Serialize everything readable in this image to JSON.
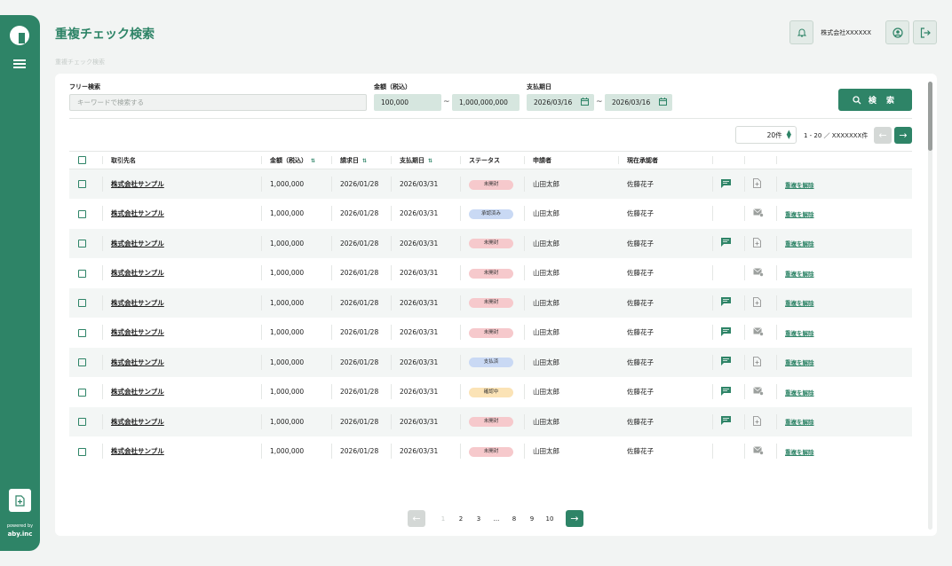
{
  "app": {
    "title": "重複チェック検索",
    "breadcrumb": "重複チェック検索",
    "company": "株式会社XXXXXX",
    "powered_by": "powered by",
    "brand": "aby.inc"
  },
  "filters": {
    "free_label": "フリー検索",
    "free_placeholder": "キーワードで検索する",
    "amount_label": "金額（税込）",
    "amount_min": "100,000",
    "amount_max": "1,000,000,000",
    "date_label": "支払期日",
    "date_from": "2026/03/16",
    "date_to": "2026/03/16",
    "tilde": "~",
    "search_label": "検 索"
  },
  "pager": {
    "per_page": "20件",
    "range": "1 - 20 ／ XXXXXXX件"
  },
  "table": {
    "headers": {
      "vendor": "取引先名",
      "amount": "金額（税込）",
      "invoice_date": "請求日",
      "due_date": "支払期日",
      "status": "ステータス",
      "applicant": "申請者",
      "approver": "現在承認者"
    },
    "rows": [
      {
        "vendor": "株式会社サンプル",
        "amount": "1,000,000",
        "invoice_date": "2026/01/28",
        "due_date": "2026/03/31",
        "status": "未開封",
        "status_color": "#f6c9cc",
        "applicant": "山田太郎",
        "approver": "佐藤花子",
        "comment": true,
        "file_icon": "doc",
        "release": "重複を解除"
      },
      {
        "vendor": "株式会社サンプル",
        "amount": "1,000,000",
        "invoice_date": "2026/01/28",
        "due_date": "2026/03/31",
        "status": "承認済み",
        "status_color": "#c9d9f4",
        "applicant": "山田太郎",
        "approver": "佐藤花子",
        "comment": false,
        "file_icon": "mail",
        "release": "重複を解除"
      },
      {
        "vendor": "株式会社サンプル",
        "amount": "1,000,000",
        "invoice_date": "2026/01/28",
        "due_date": "2026/03/31",
        "status": "未開封",
        "status_color": "#f6c9cc",
        "applicant": "山田太郎",
        "approver": "佐藤花子",
        "comment": true,
        "file_icon": "doc",
        "release": "重複を解除"
      },
      {
        "vendor": "株式会社サンプル",
        "amount": "1,000,000",
        "invoice_date": "2026/01/28",
        "due_date": "2026/03/31",
        "status": "未開封",
        "status_color": "#f6c9cc",
        "applicant": "山田太郎",
        "approver": "佐藤花子",
        "comment": false,
        "file_icon": "mail",
        "release": "重複を解除"
      },
      {
        "vendor": "株式会社サンプル",
        "amount": "1,000,000",
        "invoice_date": "2026/01/28",
        "due_date": "2026/03/31",
        "status": "未開封",
        "status_color": "#f6c9cc",
        "applicant": "山田太郎",
        "approver": "佐藤花子",
        "comment": true,
        "file_icon": "doc",
        "release": "重複を解除"
      },
      {
        "vendor": "株式会社サンプル",
        "amount": "1,000,000",
        "invoice_date": "2026/01/28",
        "due_date": "2026/03/31",
        "status": "未開封",
        "status_color": "#f6c9cc",
        "applicant": "山田太郎",
        "approver": "佐藤花子",
        "comment": true,
        "file_icon": "mail",
        "release": "重複を解除"
      },
      {
        "vendor": "株式会社サンプル",
        "amount": "1,000,000",
        "invoice_date": "2026/01/28",
        "due_date": "2026/03/31",
        "status": "支払済",
        "status_color": "#c9d9f4",
        "applicant": "山田太郎",
        "approver": "佐藤花子",
        "comment": true,
        "file_icon": "doc",
        "release": "重複を解除"
      },
      {
        "vendor": "株式会社サンプル",
        "amount": "1,000,000",
        "invoice_date": "2026/01/28",
        "due_date": "2026/03/31",
        "status": "確認中",
        "status_color": "#fbe3b6",
        "applicant": "山田太郎",
        "approver": "佐藤花子",
        "comment": true,
        "file_icon": "mail",
        "release": "重複を解除"
      },
      {
        "vendor": "株式会社サンプル",
        "amount": "1,000,000",
        "invoice_date": "2026/01/28",
        "due_date": "2026/03/31",
        "status": "未開封",
        "status_color": "#f6c9cc",
        "applicant": "山田太郎",
        "approver": "佐藤花子",
        "comment": true,
        "file_icon": "doc",
        "release": "重複を解除"
      },
      {
        "vendor": "株式会社サンプル",
        "amount": "1,000,000",
        "invoice_date": "2026/01/28",
        "due_date": "2026/03/31",
        "status": "未開封",
        "status_color": "#f6c9cc",
        "applicant": "山田太郎",
        "approver": "佐藤花子",
        "comment": false,
        "file_icon": "mail",
        "release": "重複を解除"
      }
    ]
  },
  "pagination": {
    "pages": [
      "1",
      "2",
      "3",
      "...",
      "8",
      "9",
      "10"
    ],
    "current": "1"
  },
  "colors": {
    "accent": "#2e8467",
    "accent_light": "#d6e6df"
  }
}
